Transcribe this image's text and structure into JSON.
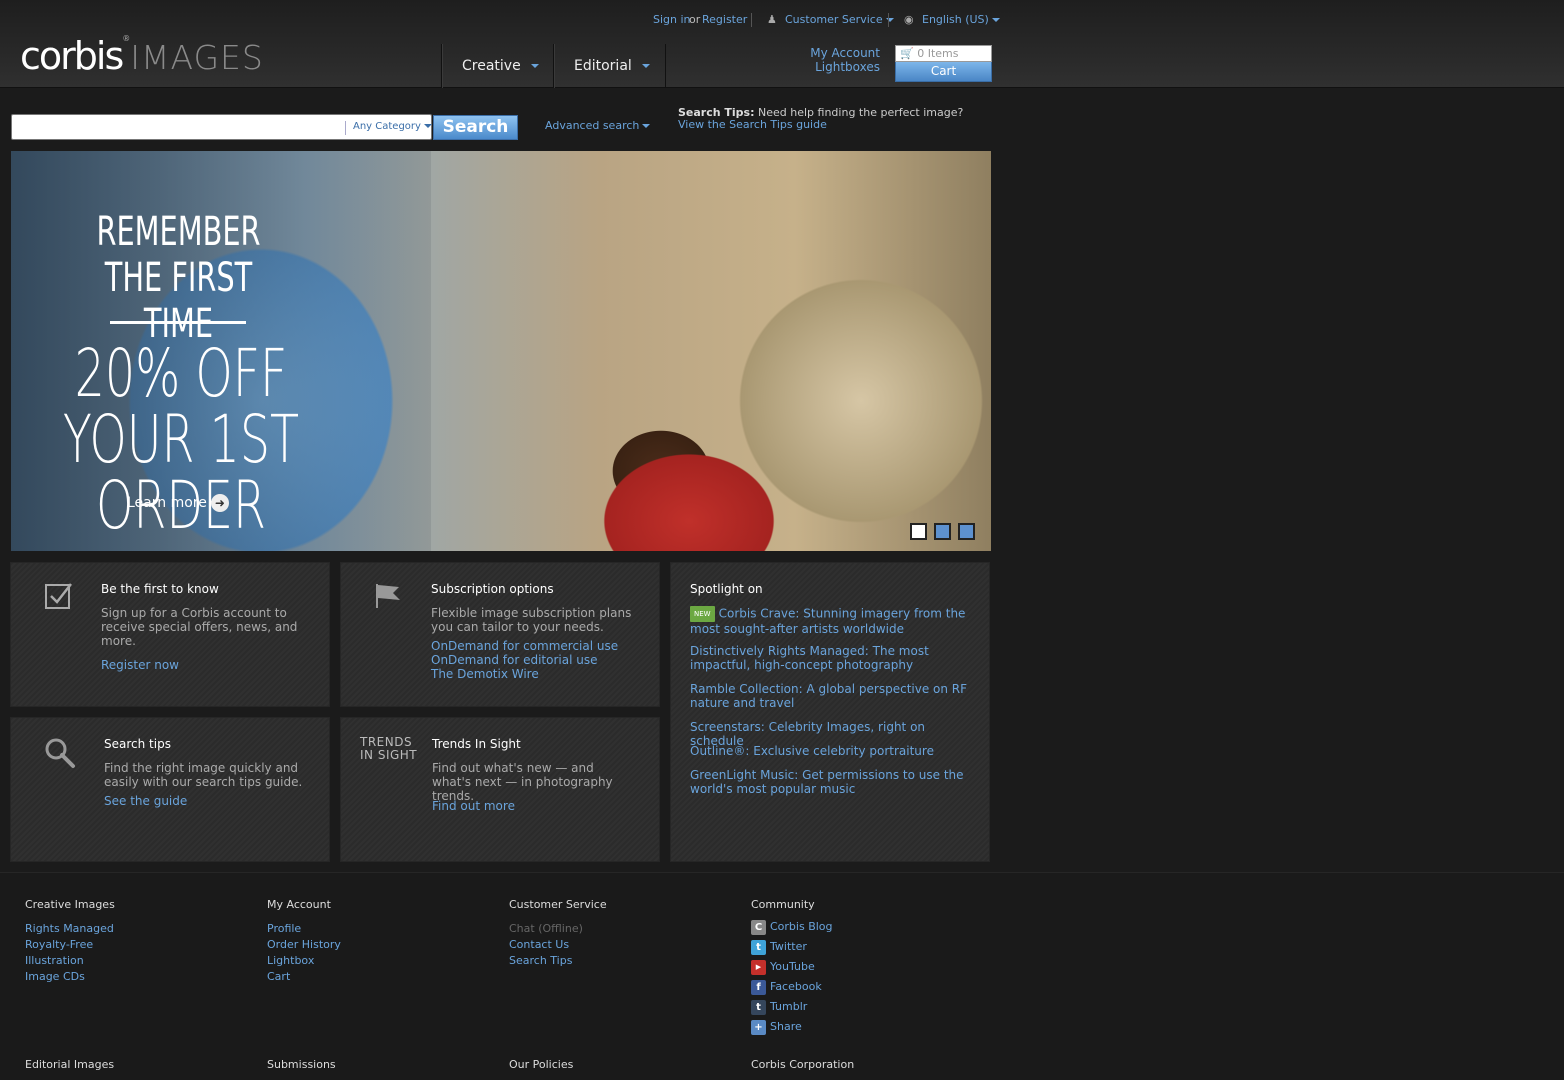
{
  "utility": {
    "signin": "Sign in",
    "or": "or",
    "register": "Register",
    "customer_service": "Customer Service",
    "language": "English (US)"
  },
  "logo": {
    "brand": "corbis",
    "sub": "IMAGES"
  },
  "nav": {
    "creative": "Creative",
    "editorial": "Editorial"
  },
  "account": {
    "my_account": "My Account",
    "lightboxes": "Lightboxes"
  },
  "cart": {
    "items": "0  Items",
    "label": "Cart"
  },
  "search": {
    "value": "",
    "category": "Any Category",
    "button": "Search",
    "advanced": "Advanced search",
    "tips_label": "Search Tips:",
    "tips_text": "Need help finding the perfect image?",
    "tips_link": "View the Search Tips guide"
  },
  "hero": {
    "headline": "REMEMBER THE FIRST TIME",
    "offer": "20% OFF YOUR 1ST ORDER",
    "cta": "Learn more",
    "active_slide": 1,
    "slide_count": 3
  },
  "panels": {
    "first": {
      "title": "Be the first to know",
      "desc": "Sign up for a Corbis account to receive special offers, news, and more.",
      "link": "Register now"
    },
    "subs": {
      "title": "Subscription options",
      "desc": "Flexible image subscription plans you can tailor to your needs.",
      "links": [
        "OnDemand for commercial use",
        "OnDemand for editorial use",
        "The Demotix Wire"
      ]
    },
    "tips": {
      "title": "Search tips",
      "desc": "Find the right image quickly and easily with our search tips guide.",
      "link": "See the guide"
    },
    "trends": {
      "logo": "TRENDS IN SIGHT",
      "title": "Trends In Sight",
      "desc": "Find out what's new — and what's next — in photography trends.",
      "link": "Find out more"
    },
    "spotlight": {
      "title": "Spotlight on",
      "badge": "NEW",
      "items": [
        "Corbis Crave: Stunning imagery from the most sought-after artists worldwide",
        "Distinctively Rights Managed: The most impactful, high-concept photography",
        "Ramble Collection: A global perspective on RF nature and travel",
        "Screenstars: Celebrity Images, right on schedule",
        "Outline®: Exclusive celebrity portraiture",
        "GreenLight Music: Get permissions to use the world's most popular music"
      ]
    }
  },
  "footer": {
    "creative": {
      "title": "Creative Images",
      "links": [
        "Rights Managed",
        "Royalty-Free",
        "Illustration",
        "Image CDs"
      ]
    },
    "account": {
      "title": "My Account",
      "links": [
        "Profile",
        "Order History",
        "Lightbox",
        "Cart"
      ]
    },
    "service": {
      "title": "Customer Service",
      "chat": "Chat (Offline)",
      "links": [
        "Contact Us",
        "Search Tips"
      ]
    },
    "community": {
      "title": "Community",
      "links": [
        "Corbis Blog",
        "Twitter",
        "YouTube",
        "Facebook",
        "Tumblr",
        "Share"
      ]
    },
    "bottom": [
      "Editorial Images",
      "Submissions",
      "Our Policies",
      "Corbis Corporation"
    ]
  },
  "colors": {
    "link": "#6aa4dc",
    "accent": "#4b8acb",
    "new_badge": "#6ca842"
  }
}
